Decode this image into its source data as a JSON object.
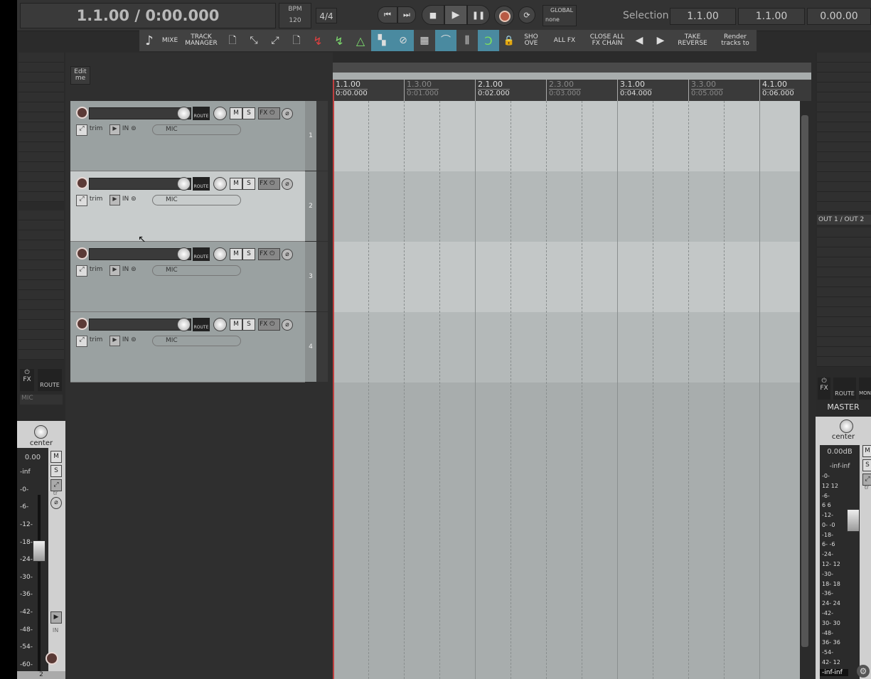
{
  "transport": {
    "position": "1.1.00 / 0:00.000",
    "bpm_label": "BPM",
    "bpm_value": "120",
    "time_sig": "4/4",
    "global_label": "GLOBAL",
    "global_value": "none",
    "selection_label": "Selection:",
    "selection_start": "1.1.00",
    "selection_end": "1.1.00",
    "selection_length": "0.00.00"
  },
  "toolbar": {
    "mixer": "MIXE",
    "track_manager": "TRACK\nMANAGER",
    "show_overlay": "SHO\nOVE",
    "all_fx": "ALL FX",
    "close_all_fx": "CLOSE ALL\nFX CHAIN",
    "take_reverse": "TAKE\nREVERSE",
    "render": "Render\ntracks to"
  },
  "edit_me": "Edit\nme",
  "tracks": [
    {
      "number": "1",
      "trim": "trim",
      "in": "IN",
      "input": "MIC",
      "m": "M",
      "s": "S",
      "fx": "FX",
      "route": "ROUTE"
    },
    {
      "number": "2",
      "trim": "trim",
      "in": "IN",
      "input": "MIC",
      "m": "M",
      "s": "S",
      "fx": "FX",
      "route": "ROUTE"
    },
    {
      "number": "3",
      "trim": "trim",
      "in": "IN",
      "input": "MIC",
      "m": "M",
      "s": "S",
      "fx": "FX",
      "route": "ROUTE"
    },
    {
      "number": "4",
      "trim": "trim",
      "in": "IN",
      "input": "MIC",
      "m": "M",
      "s": "S",
      "fx": "FX",
      "route": "ROUTE"
    }
  ],
  "ruler": [
    {
      "measure": "1.1.00",
      "time": "0:00.000",
      "major": true
    },
    {
      "measure": "1.3.00",
      "time": "0:01.000",
      "major": false
    },
    {
      "measure": "2.1.00",
      "time": "0:02.000",
      "major": true
    },
    {
      "measure": "2.3.00",
      "time": "0:03.000",
      "major": false
    },
    {
      "measure": "3.1.00",
      "time": "0:04.000",
      "major": true
    },
    {
      "measure": "3.3.00",
      "time": "0:05.000",
      "major": false
    },
    {
      "measure": "4.1.00",
      "time": "0:06.000",
      "major": true
    }
  ],
  "left_channel": {
    "fx": "FX",
    "route": "ROUTE",
    "input": "MIC",
    "pan": "center",
    "volume": "0.00",
    "m": "M",
    "s": "S",
    "tr": "tr",
    "in": "IN",
    "number": "2",
    "scale": [
      "-inf",
      "-0-",
      "-6-",
      "-12-",
      "-18-",
      "-24-",
      "-30-",
      "-36-",
      "-42-",
      "-48-",
      "-54-",
      "-60-"
    ]
  },
  "master": {
    "output": "OUT 1 / OUT 2",
    "fx": "FX",
    "route": "ROUTE",
    "mon": "MON",
    "name": "MASTER",
    "pan": "center",
    "volume": "0.00dB",
    "m": "M",
    "s": "S",
    "tr": "tr",
    "peak": "-inf-inf",
    "peak_bottom": "-inf-inf",
    "scale": [
      "-0-",
      "12  12",
      "-6-",
      "6   6",
      "-12-",
      "0-  -0",
      "-18-",
      "6-  -6",
      "-24-",
      "12-  12",
      "-30-",
      "18-  18",
      "-36-",
      "24-  24",
      "-42-",
      "30-  30",
      "-48-",
      "36-  36",
      "-54-",
      "42-  12"
    ]
  }
}
